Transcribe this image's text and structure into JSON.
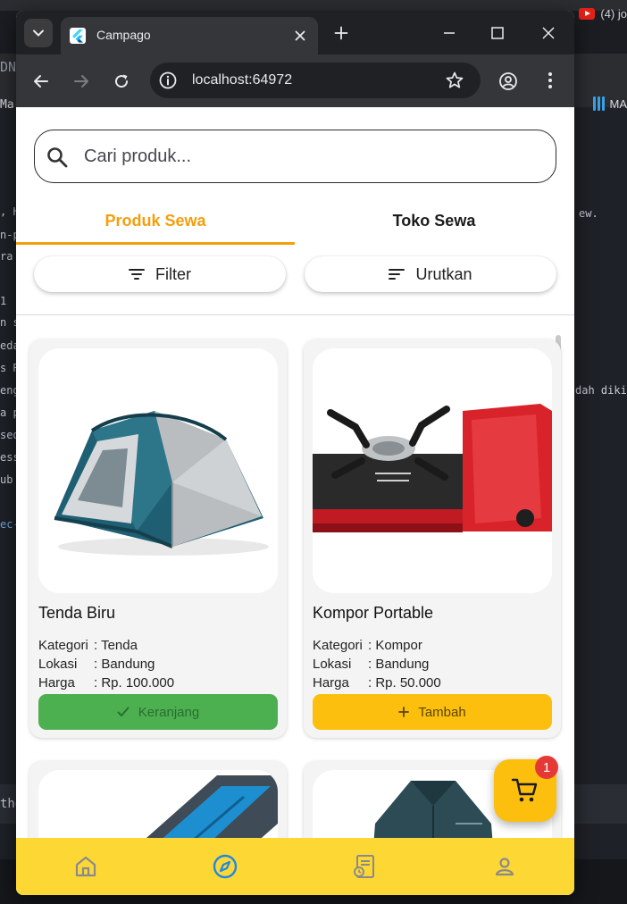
{
  "background": {
    "youtube_tab_text": "(4) jo",
    "bookmark_text": "MA",
    "code_lines": [
      {
        "text": "",
        "y": 0
      },
      {
        "text": ", H",
        "y": 0
      },
      {
        "text": "n-p",
        "y": 0
      },
      {
        "text": "ra",
        "y": 0
      },
      {
        "text": "1",
        "y": 0
      },
      {
        "text": "n s",
        "y": 0
      },
      {
        "text": "eda",
        "y": 0
      },
      {
        "text": "s R",
        "y": 0
      },
      {
        "text": "eng",
        "y": 0
      },
      {
        "text": "a p",
        "y": 0
      },
      {
        "text": "sed",
        "y": 0
      },
      {
        "text": "ess",
        "y": 0
      },
      {
        "text": "ub",
        "y": 0
      },
      {
        "text": "ec-",
        "y": 0
      }
    ],
    "right_code_1": "ew.",
    "right_code_2": "dah diki",
    "strip_text": "the",
    "tab_left_text": "DN",
    "bm_left_text": "Ma"
  },
  "browser": {
    "tab_title": "Campago",
    "url": "localhost:64972"
  },
  "app": {
    "search_placeholder": "Cari produk...",
    "tabs": [
      "Produk Sewa",
      "Toko Sewa"
    ],
    "filter_label": "Filter",
    "sort_label": "Urutkan",
    "products": [
      {
        "name": "Tenda Biru",
        "category_label": "Kategori",
        "category": ": Tenda",
        "location_label": "Lokasi",
        "location": ": Bandung",
        "price_label": "Harga",
        "price": ": Rp. 100.000",
        "action_label": "Keranjang",
        "action_icon": "check-icon"
      },
      {
        "name": "Kompor Portable",
        "category_label": "Kategori",
        "category": ": Kompor",
        "location_label": "Lokasi",
        "location": ": Bandung",
        "price_label": "Harga",
        "price": ": Rp. 50.000",
        "action_label": "Tambah",
        "action_icon": "plus-icon"
      }
    ],
    "cart_count": "1",
    "colors": {
      "accent": "#f59e0b",
      "yellow": "#fcbf0e",
      "nav_yellow": "#fdd835",
      "green": "#4caf50",
      "badge_red": "#e53935"
    },
    "bottom_nav": [
      "home-icon",
      "explore-icon",
      "orders-icon",
      "profile-icon"
    ]
  }
}
